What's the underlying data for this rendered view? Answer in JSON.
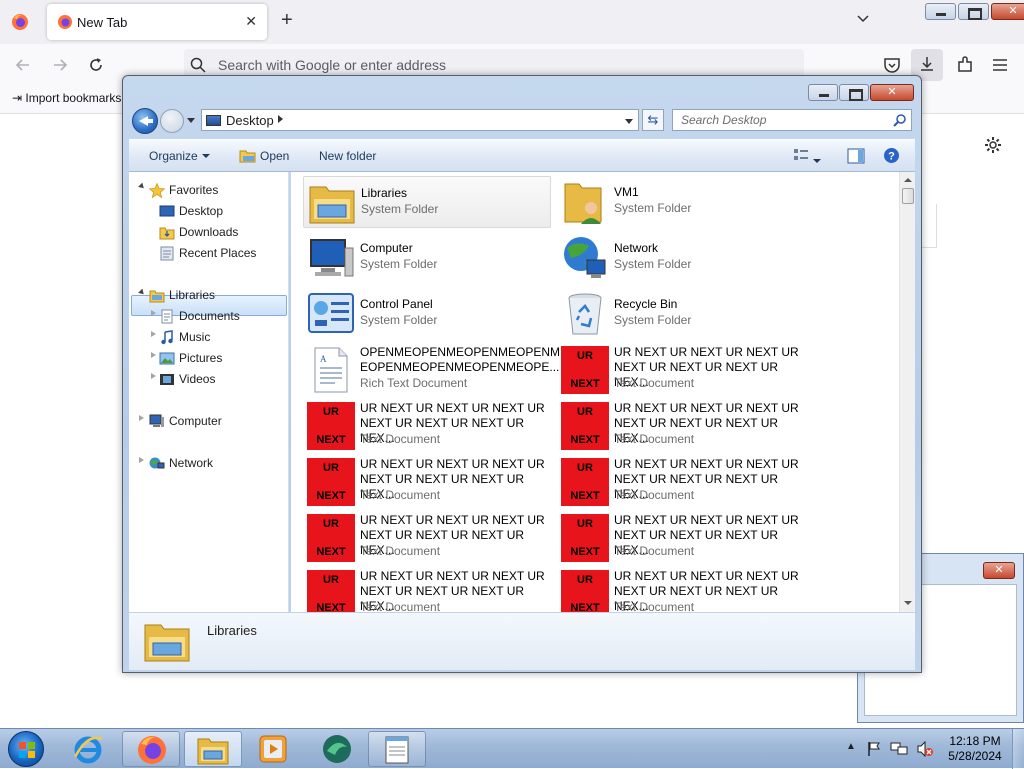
{
  "firefox": {
    "tab_title": "New Tab",
    "url_placeholder": "Search with Google or enter address",
    "bookmark_item": "Import bookmarks..."
  },
  "explorer": {
    "address": "Desktop",
    "search_placeholder": "Search Desktop",
    "toolbar": {
      "organize": "Organize",
      "open": "Open",
      "new_folder": "New folder"
    },
    "nav": {
      "favorites": "Favorites",
      "desktop": "Desktop",
      "downloads": "Downloads",
      "recent_places": "Recent Places",
      "libraries": "Libraries",
      "documents": "Documents",
      "music": "Music",
      "pictures": "Pictures",
      "videos": "Videos",
      "computer": "Computer",
      "network": "Network"
    },
    "items": [
      {
        "name": "Libraries",
        "type": "System Folder",
        "icon": "libraries-icon"
      },
      {
        "name": "VM1",
        "type": "System Folder",
        "icon": "user-folder-icon"
      },
      {
        "name": "Computer",
        "type": "System Folder",
        "icon": "computer-icon"
      },
      {
        "name": "Network",
        "type": "System Folder",
        "icon": "network-icon"
      },
      {
        "name": "Control Panel",
        "type": "System Folder",
        "icon": "control-panel-icon"
      },
      {
        "name": "Recycle Bin",
        "type": "System Folder",
        "icon": "recycle-bin-icon"
      },
      {
        "name_line1": "OPENMEOPENMEOPENMEOPENM",
        "name_line2": "EOPENMEOPENMEOPENMEOPE...",
        "type": "Rich Text Document",
        "icon": "rtf-document-icon"
      },
      {
        "name_line1": "UR NEXT UR NEXT UR NEXT UR",
        "name_line2": "NEXT UR NEXT UR NEXT UR NEX...",
        "type": "Text Document",
        "icon": "ur-next-icon"
      }
    ],
    "ur_next_file": {
      "name_line1": "UR NEXT UR NEXT UR NEXT UR",
      "name_line2": "NEXT UR NEXT UR NEXT UR NEX...",
      "type": "Text Document",
      "thumb_top": "UR",
      "thumb_bottom": "NEXT"
    },
    "details_label": "Libraries",
    "highlight_color": "#e8141c"
  },
  "taskbar": {
    "time": "12:18 PM",
    "date": "5/28/2024"
  }
}
